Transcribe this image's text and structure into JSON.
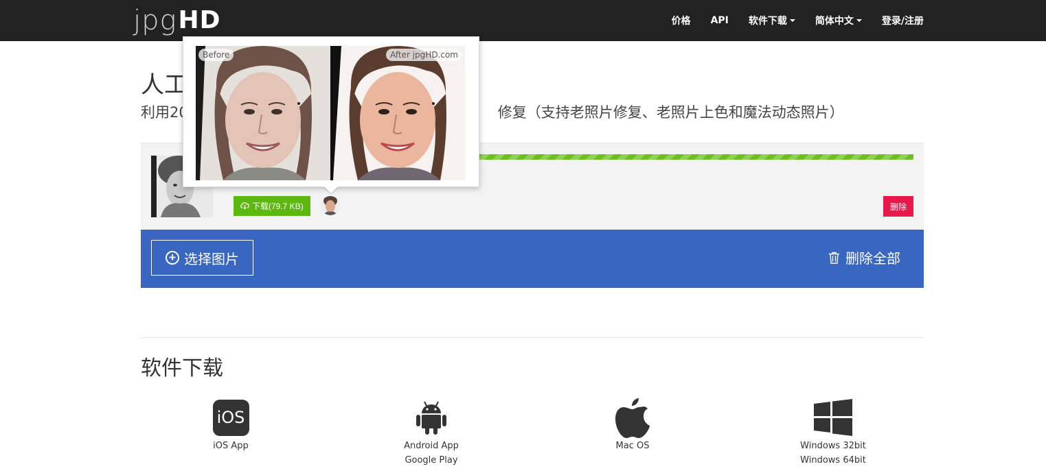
{
  "logo": {
    "light": "jpg",
    "bold": "HD"
  },
  "nav": {
    "items": [
      {
        "label": "价格"
      },
      {
        "label": "API"
      },
      {
        "label": "软件下载",
        "dropdown": true
      },
      {
        "label": "简体中文",
        "dropdown": true
      },
      {
        "label": "登录/注册"
      }
    ]
  },
  "hero": {
    "title": "人工",
    "subtitle_start": "利用20",
    "subtitle_end": "修复（支持老照片修复、老照片上色和魔法动态照片）"
  },
  "preview": {
    "before_label": "Before",
    "after_label": "After jpgHD.com"
  },
  "file": {
    "progress_percent": 100,
    "download_label": "下载(79.7 KB)",
    "delete_label": "删除"
  },
  "actions": {
    "select_label": "选择图片",
    "delete_all_label": "删除全部"
  },
  "software": {
    "title": "软件下载",
    "platforms": [
      {
        "icon": "ios-icon",
        "badge": "iOS",
        "lines": [
          "iOS App"
        ]
      },
      {
        "icon": "android-icon",
        "lines": [
          "Android App",
          "Google Play"
        ]
      },
      {
        "icon": "apple-icon",
        "lines": [
          "Mac OS"
        ]
      },
      {
        "icon": "windows-icon",
        "lines": [
          "Windows 32bit",
          "Windows 64bit"
        ]
      }
    ]
  },
  "colors": {
    "navbar": "#222222",
    "progress": "#6cbf1d",
    "download": "#5cb80e",
    "delete": "#e8184a",
    "action_bar": "#3866c0"
  }
}
